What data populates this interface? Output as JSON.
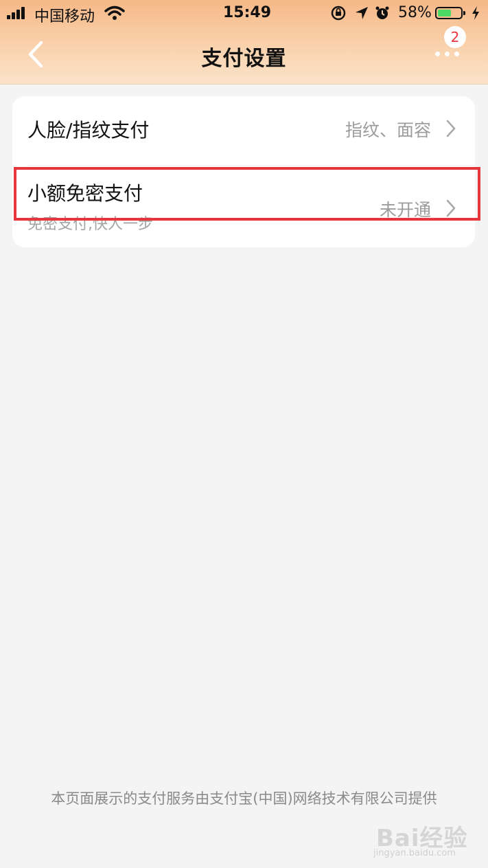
{
  "status_bar": {
    "carrier": "中国移动",
    "time": "15:49",
    "battery_percent": "58%",
    "battery_level": 0.58,
    "icons": [
      "signal-icon",
      "wifi-icon",
      "rotation-lock-icon",
      "location-icon",
      "alarm-icon",
      "battery-icon",
      "charging-icon"
    ]
  },
  "nav": {
    "title": "支付设置",
    "back_icon": "chevron-left-icon",
    "more_icon": "more-dots-icon",
    "badge_count": "2"
  },
  "settings": [
    {
      "title": "人脸/指纹支付",
      "value": "指纹、面容"
    },
    {
      "title": "小额免密支付",
      "subtitle": "免密支付,快人一步",
      "value": "未开通"
    }
  ],
  "footer": "本页面展示的支付服务由支付宝(中国)网络技术有限公司提供",
  "watermark": {
    "text": "Bai经验",
    "sub": "jingyan.baidu.com"
  },
  "colors": {
    "accent_red": "#e8343b",
    "header_gradient_top": "#f6b887",
    "battery_green": "#4cd964"
  }
}
